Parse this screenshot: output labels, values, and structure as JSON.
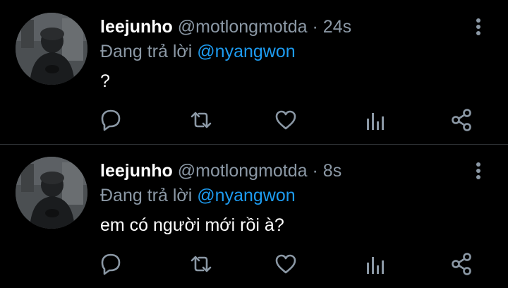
{
  "colors": {
    "background": "#000000",
    "name": "#ffffff",
    "secondary": "#8b98a5",
    "mention": "#1d9bf0",
    "divider": "#2f3336"
  },
  "tweets": [
    {
      "display_name": "leejunho",
      "handle": "@motlongmotda",
      "separator": "·",
      "time": "24s",
      "reply_prefix": "Đang trả lời",
      "reply_to": "@nyangwon",
      "text": "?",
      "actions": [
        "reply-icon",
        "retweet-icon",
        "like-icon",
        "views-icon",
        "share-icon"
      ]
    },
    {
      "display_name": "leejunho",
      "handle": "@motlongmotda",
      "separator": "·",
      "time": "8s",
      "reply_prefix": "Đang trả lời",
      "reply_to": "@nyangwon",
      "text": "em có người mới rồi à?",
      "actions": [
        "reply-icon",
        "retweet-icon",
        "like-icon",
        "views-icon",
        "share-icon"
      ]
    }
  ]
}
